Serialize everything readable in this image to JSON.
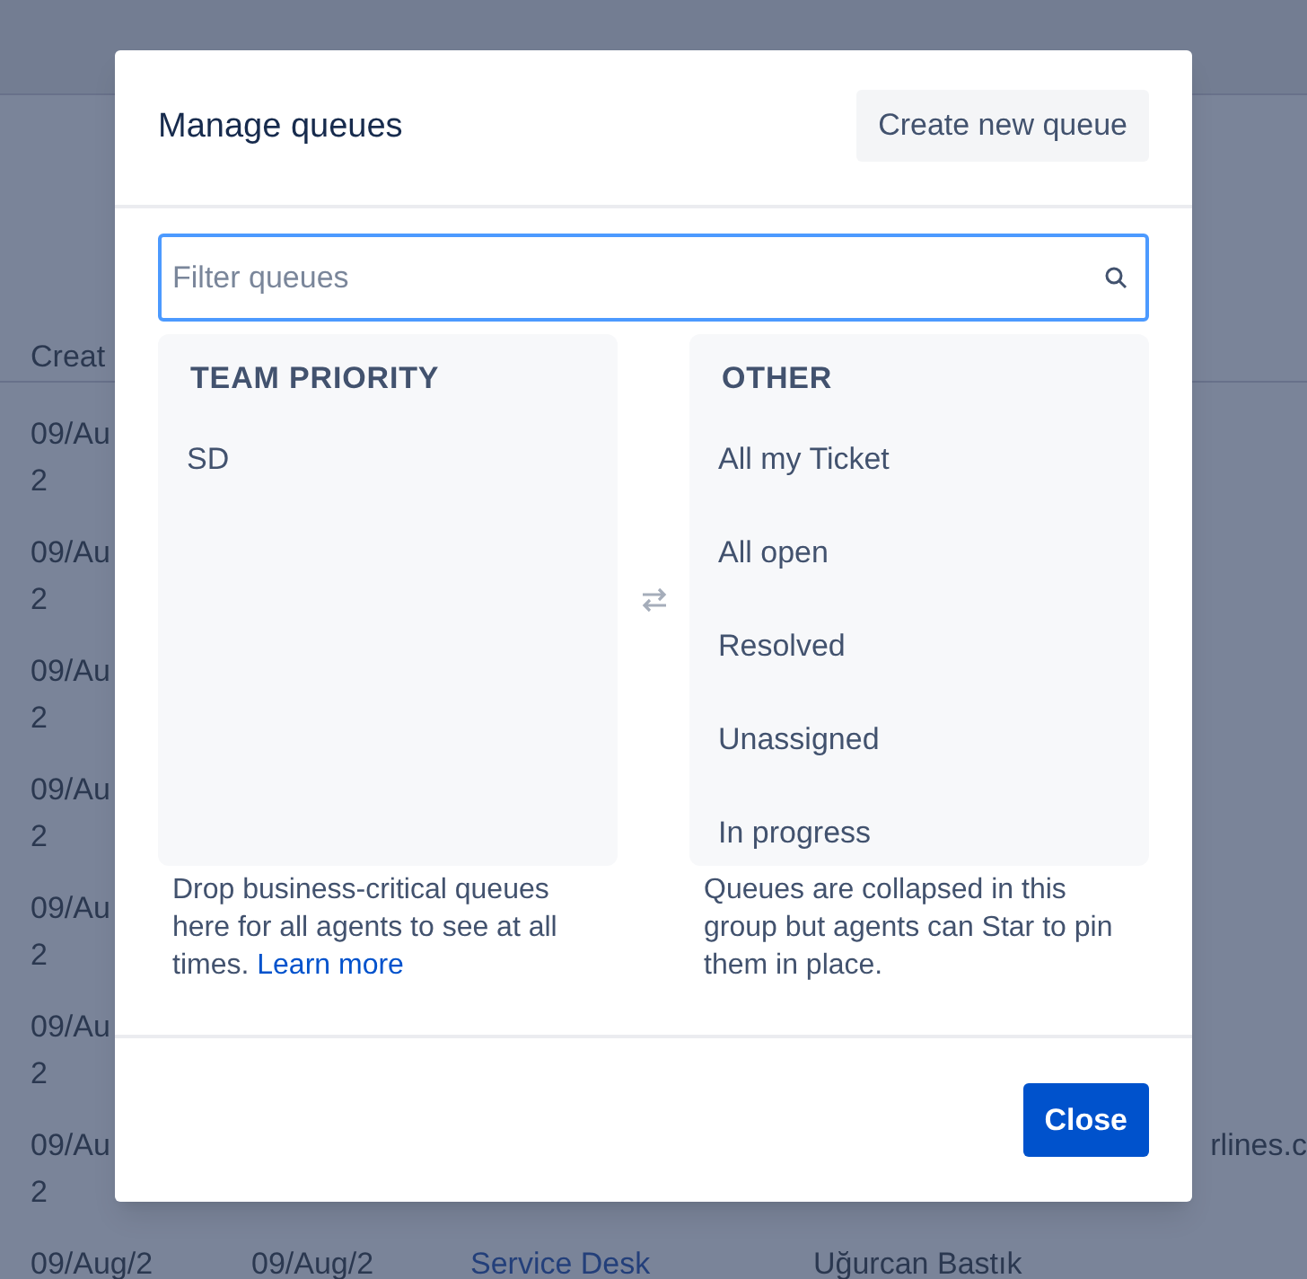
{
  "background_table": {
    "header": "Creat",
    "rows": [
      {
        "cells": [
          {
            "kind": "text",
            "lines": [
              "09/Au",
              "2"
            ]
          }
        ]
      },
      {
        "cells": [
          {
            "kind": "text",
            "lines": [
              "09/Au",
              "2"
            ]
          }
        ]
      },
      {
        "cells": [
          {
            "kind": "text",
            "lines": [
              "09/Au",
              "2"
            ]
          }
        ]
      },
      {
        "cells": [
          {
            "kind": "text",
            "lines": [
              "09/Au",
              "2"
            ]
          }
        ]
      },
      {
        "cells": [
          {
            "kind": "text",
            "lines": [
              "09/Au",
              "2"
            ]
          }
        ]
      },
      {
        "cells": [
          {
            "kind": "text",
            "lines": [
              "09/Au",
              "2"
            ]
          }
        ]
      },
      {
        "cells": [
          {
            "kind": "text",
            "lines": [
              "09/Au",
              "2"
            ]
          },
          {
            "kind": "edge",
            "lines": [
              "rlines.c"
            ]
          }
        ]
      },
      {
        "cells": [
          {
            "kind": "text",
            "lines": [
              "09/Aug/2"
            ]
          },
          {
            "kind": "text",
            "lines": [
              "09/Aug/2"
            ]
          },
          {
            "kind": "link",
            "lines": [
              "Service Desk"
            ]
          },
          {
            "kind": "text",
            "lines": [
              "Uğurcan Bastık"
            ]
          }
        ]
      }
    ]
  },
  "dialog": {
    "title": "Manage queues",
    "create_button": "Create new queue",
    "filter": {
      "placeholder": "Filter queues"
    },
    "groups": [
      {
        "heading": "TEAM PRIORITY",
        "queues": [
          "SD"
        ],
        "description": "Drop business-critical queues here for all agents to see at all times.",
        "link": "Learn more"
      },
      {
        "heading": "OTHER",
        "queues": [
          "All my Ticket",
          "All open",
          "Resolved",
          "Unassigned",
          "In progress"
        ],
        "description": "Queues are collapsed in this group but agents can Star to pin them in place."
      }
    ],
    "close_button": "Close"
  }
}
